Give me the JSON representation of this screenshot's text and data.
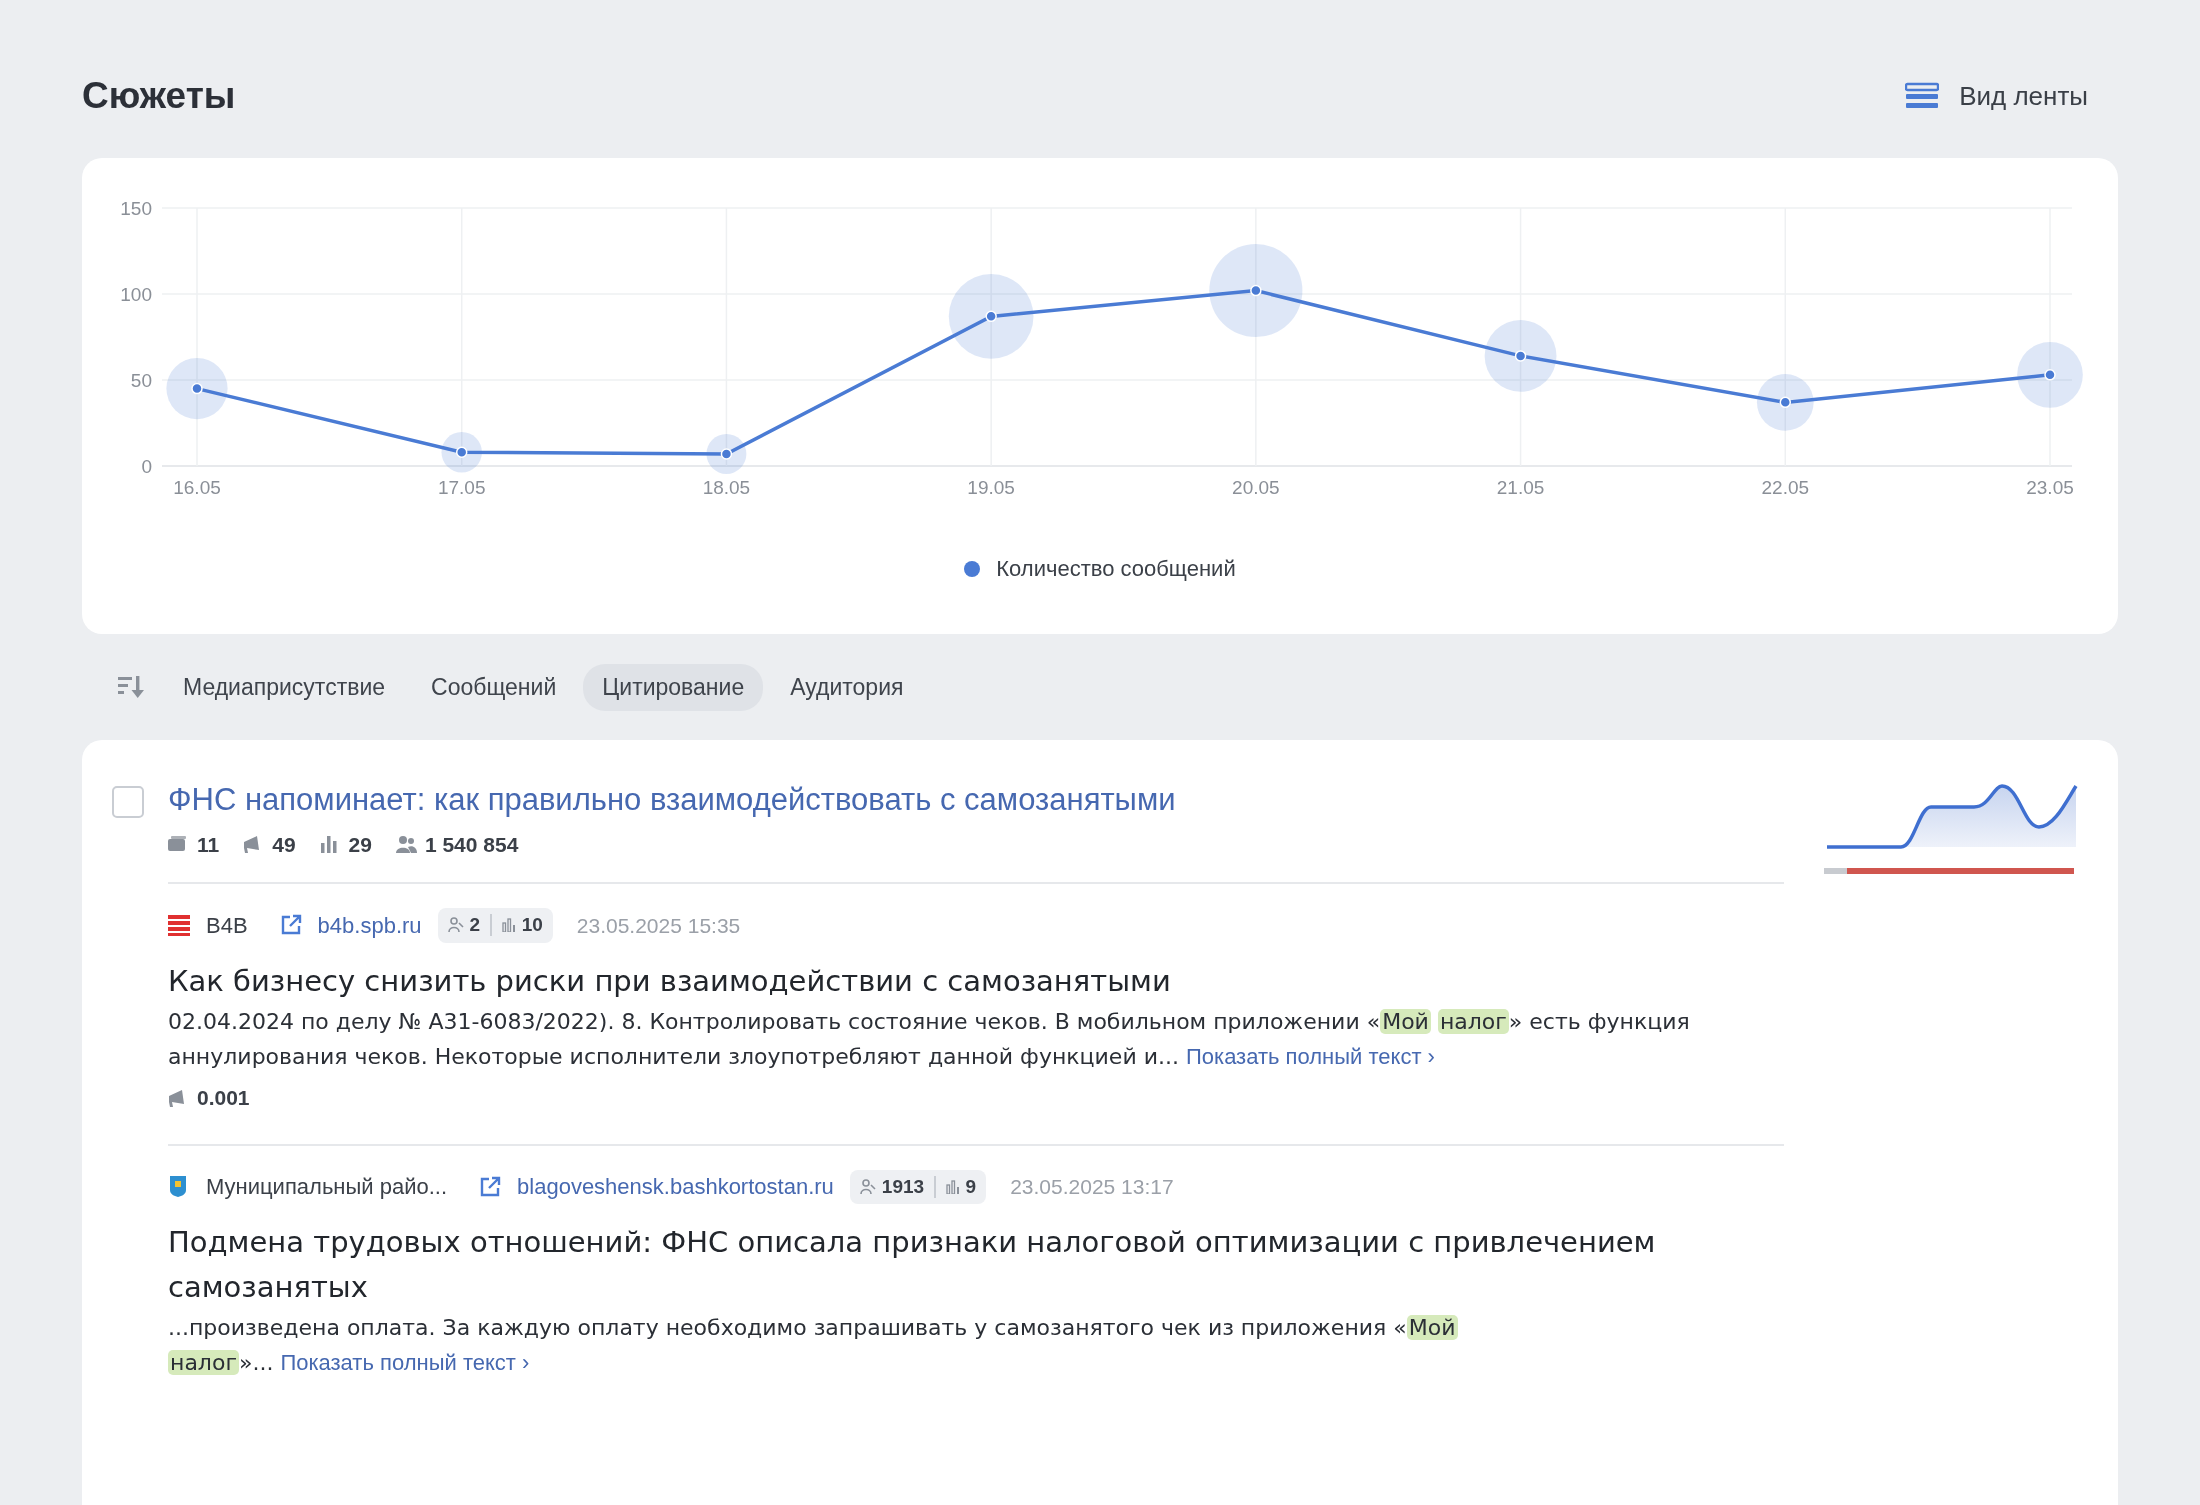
{
  "page": {
    "title": "Сюжеты",
    "view_toggle": "Вид ленты"
  },
  "chart": {
    "chart_data": {
      "type": "line",
      "categories": [
        "16.05",
        "17.05",
        "18.05",
        "19.05",
        "20.05",
        "21.05",
        "22.05",
        "23.05"
      ],
      "series": [
        {
          "name": "Количество сообщений",
          "color": "#4a7bd4",
          "marker": true,
          "values": [
            45,
            8,
            7,
            87,
            102,
            64,
            37,
            53
          ]
        }
      ],
      "ylim": [
        0,
        150
      ],
      "yticks": [
        0,
        50,
        100,
        150
      ],
      "grid": true
    }
  },
  "sort_tabs": [
    {
      "label": "Медиаприсутствие",
      "selected": false
    },
    {
      "label": "Сообщений",
      "selected": false
    },
    {
      "label": "Цитирование",
      "selected": true
    },
    {
      "label": "Аудитория",
      "selected": false
    }
  ],
  "story": {
    "checked": false,
    "title": "ФНС напоминает: как правильно взаимодействовать с самозанятыми",
    "metrics": [
      {
        "kind": "articles",
        "value": "11"
      },
      {
        "kind": "reposts",
        "value": "49"
      },
      {
        "kind": "citation",
        "value": "29"
      },
      {
        "kind": "audience",
        "value": "1 540 854"
      }
    ],
    "sentiment_bar": {
      "level": 0.91
    },
    "articles": [
      {
        "kind": "stripes",
        "source": "B4B",
        "domain": "b4b.spb.ru",
        "authors": "2",
        "score": "10",
        "date": "23.05.2025 15:35",
        "headline": "Как бизнесу снизить риски при взаимодействии с самозанятыми",
        "snippet": "02.04.2024 по делу № А31-6083/2022). 8. Контролировать состояние чеков. В мобильном приложении «**Мой** **налог**» есть функция аннулирования чеков. Некоторые исполнители злоупотребляют данной функцией и...",
        "more": "Показать полный текст ›",
        "stat": "0.001"
      },
      {
        "kind": "shield",
        "source": "Муниципальный райо...",
        "domain": "blagoveshensk.bashkortostan.ru",
        "authors": "1913",
        "score": "9",
        "date": "23.05.2025 13:17",
        "headline": "Подмена трудовых отношений: ФНС описала признаки налоговой оптимизации с привлечением самозанятых",
        "snippet": "...произведена оплата. За каждую оплату необходимо запрашивать у самозанятого чек из приложения «**Мой** **налог**»...",
        "more": "Показать полный текст ›"
      }
    ]
  }
}
